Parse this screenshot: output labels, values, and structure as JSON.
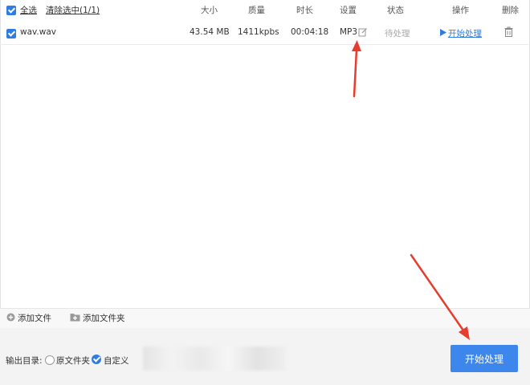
{
  "header": {
    "select_all": "全选",
    "clear_selected": "清除选中(1/1)",
    "columns": {
      "size": "大小",
      "quality": "质量",
      "duration": "时长",
      "settings": "设置",
      "status": "状态",
      "action": "操作",
      "delete": "删除"
    }
  },
  "files": [
    {
      "name": "wav.wav",
      "size": "43.54 MB",
      "quality": "1411kpbs",
      "duration": "00:04:18",
      "format": "MP3",
      "status": "待处理",
      "action": "开始处理"
    }
  ],
  "toolbar": {
    "add_file": "添加文件",
    "add_folder": "添加文件夹"
  },
  "output": {
    "label": "输出目录:",
    "option_source": "原文件夹",
    "option_custom": "自定义",
    "selected": "自定义"
  },
  "start_button": "开始处理",
  "colors": {
    "accent": "#2f7de1",
    "button": "#3d86ec",
    "arrow": "#e53d2f"
  },
  "icons": [
    "edit-icon",
    "play-icon",
    "trash-icon",
    "plus-circle-icon",
    "folder-plus-icon"
  ]
}
